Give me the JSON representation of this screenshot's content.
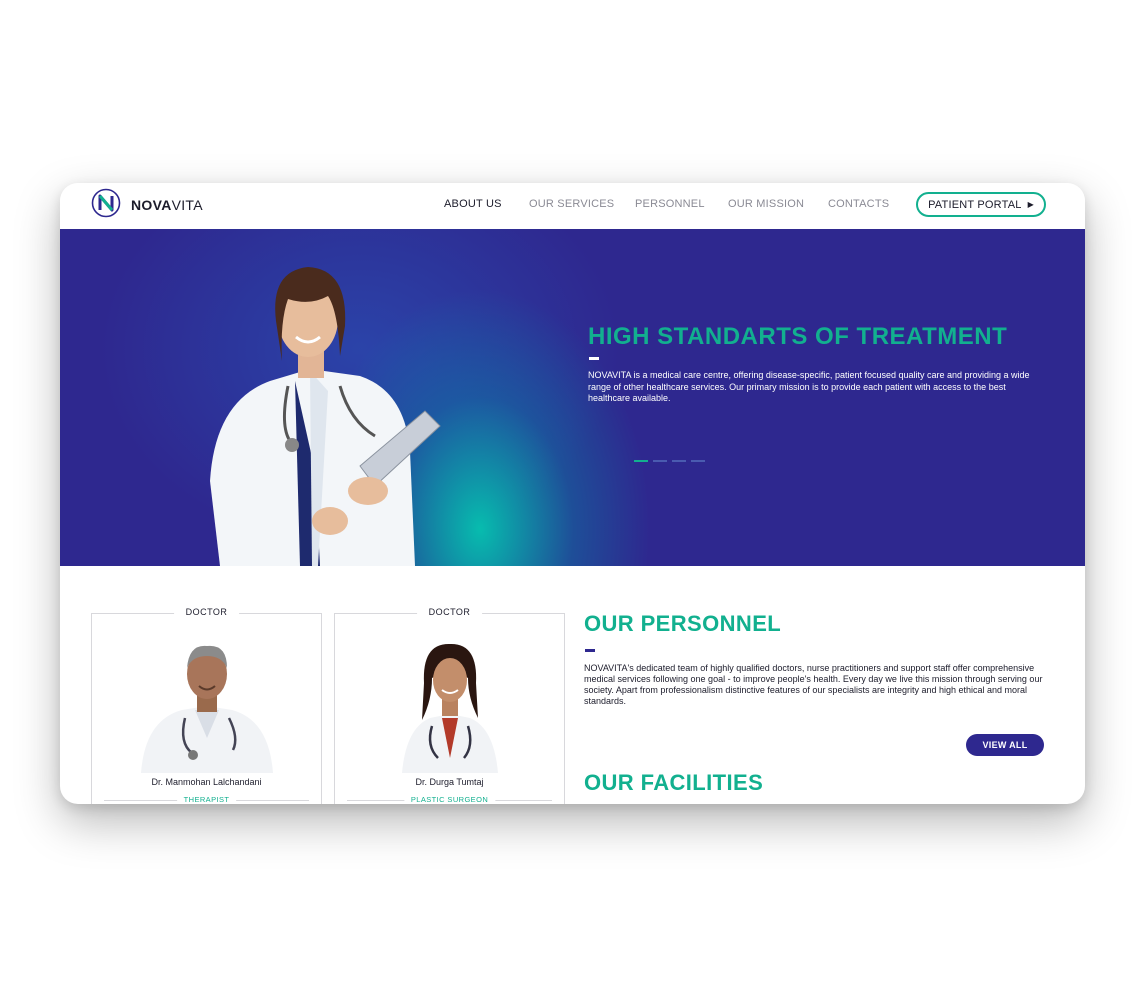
{
  "brand": {
    "name_bold": "NOVA",
    "name_light": "VITA",
    "logo_letter": "N"
  },
  "nav": {
    "items": [
      {
        "label": "ABOUT US",
        "active": true
      },
      {
        "label": "OUR SERVICES",
        "active": false
      },
      {
        "label": "PERSONNEL",
        "active": false
      },
      {
        "label": "OUR MISSION",
        "active": false
      },
      {
        "label": "CONTACTS",
        "active": false
      }
    ],
    "portal_label": "PATIENT PORTAL",
    "portal_icon": "play-arrow-icon"
  },
  "hero": {
    "title": "HIGH STANDARTS OF TREATMENT",
    "text": "NOVAVITA is a medical care centre, offering disease-specific, patient focused quality care and providing a wide range of other healthcare services. Our primary mission is to provide each patient with access to the best healthcare available.",
    "slides_total": 4,
    "slide_active": 1
  },
  "personnel": {
    "title": "OUR PERSONNEL",
    "text": "NOVAVITA's dedicated team of highly qualified doctors, nurse practitioners and support staff offer comprehensive medical services following one goal - to improve people's health. Every day we live this mission through serving our society. Apart from professionalism distinctive features of our specialists are integrity and high ethical and moral standards.",
    "view_all_label": "VIEW ALL",
    "cards": [
      {
        "tag": "DOCTOR",
        "name": "Dr. Manmohan Lalchandani",
        "role": "THERAPIST"
      },
      {
        "tag": "DOCTOR",
        "name": "Dr. Durga Tumtaj",
        "role": "PLASTIC SURGEON"
      }
    ]
  },
  "facilities": {
    "title": "OUR FACILITIES"
  },
  "colors": {
    "brand_green": "#12b08f",
    "brand_indigo": "#2e288f",
    "text_dark": "#1c1c2b"
  }
}
